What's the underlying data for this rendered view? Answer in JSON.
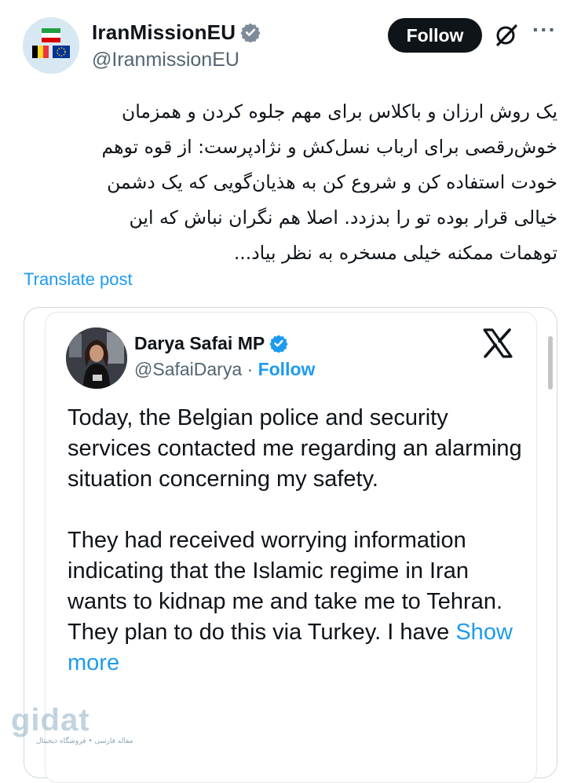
{
  "post": {
    "author_name": "IranMissionEU",
    "author_handle": "@IranmissionEU",
    "follow_label": "Follow",
    "body_lines": [
      "یک روش ارزان و باکلاس برای مهم جلوه کردن و همزمان",
      "خوش‌رقصی برای ارباب نسل‌کش و نژادپرست: از قوه توهم",
      "خودت استفاده کن و شروع کن به هذیان‌گویی که یک دشمن",
      "خیالی قرار بوده تو را بدزدد. اصلا هم نگران نباش که این",
      "توهمات ممکنه خیلی مسخره به نظر بیاد..."
    ],
    "translate_label": "Translate post"
  },
  "quoted": {
    "author_name": "Darya Safai MP",
    "author_handle": "@SafaiDarya",
    "separator": " · ",
    "follow_label": "Follow",
    "paragraph1": "Today, the Belgian police and security services contacted me regarding an alarming situation concerning my safety.",
    "paragraph2": "They had received worrying information indicating that the Islamic regime in Iran wants to kidnap me and take me to Tehran.",
    "paragraph3_start": "They plan to do this via Turkey. I have",
    "show_more_label": "Show more"
  },
  "watermark": {
    "logo_text": "gidat",
    "subtitle": "مقاله فارسی • فروشگاه دیجیتال"
  },
  "colors": {
    "accent": "#1d9bf0",
    "text": "#0f1419",
    "secondary": "#536471",
    "follow_bg": "#0f1419"
  },
  "icons": [
    "verified-badge-icon",
    "grok-icon",
    "more-icon",
    "x-logo-icon"
  ]
}
